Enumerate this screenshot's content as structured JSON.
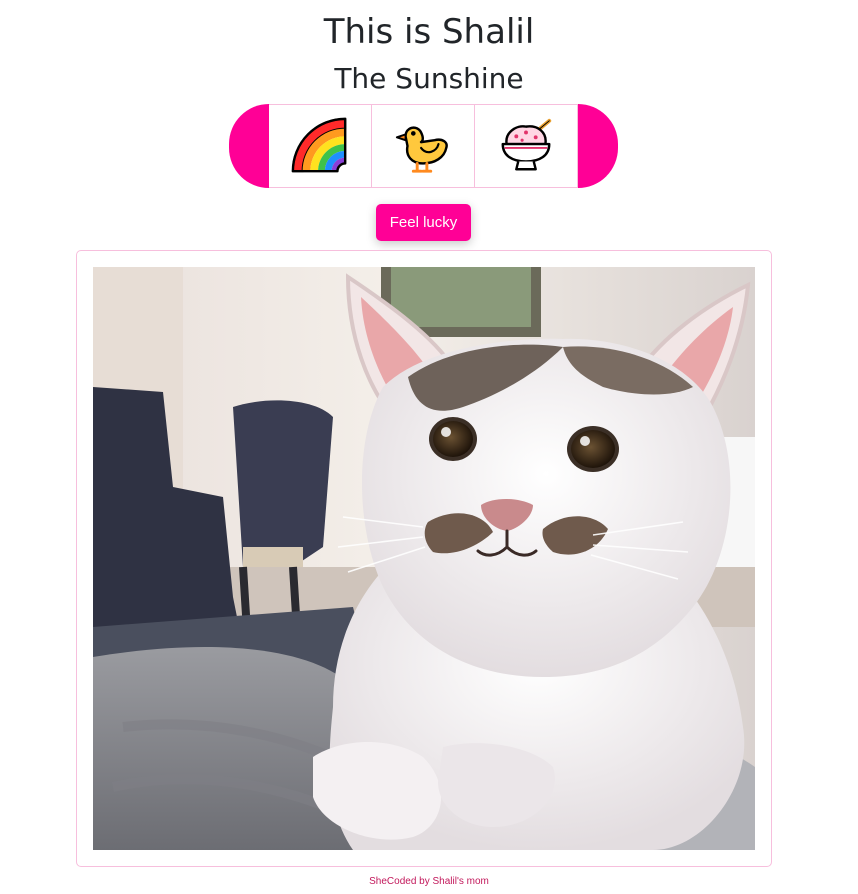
{
  "header": {
    "title": "This is Shalil",
    "subtitle": "The Sunshine"
  },
  "emoji_buttons": [
    {
      "icon": "rainbow-icon"
    },
    {
      "icon": "baby-chick-icon"
    },
    {
      "icon": "shaved-ice-icon"
    }
  ],
  "actions": {
    "lucky_label": "Feel lucky"
  },
  "photo": {
    "subject": "cat-photo"
  },
  "footer": {
    "credit": "SheCoded by Shalil's mom"
  },
  "colors": {
    "accent": "#ff0096",
    "border": "#f7bfdd",
    "footer_link": "#c2185b"
  }
}
